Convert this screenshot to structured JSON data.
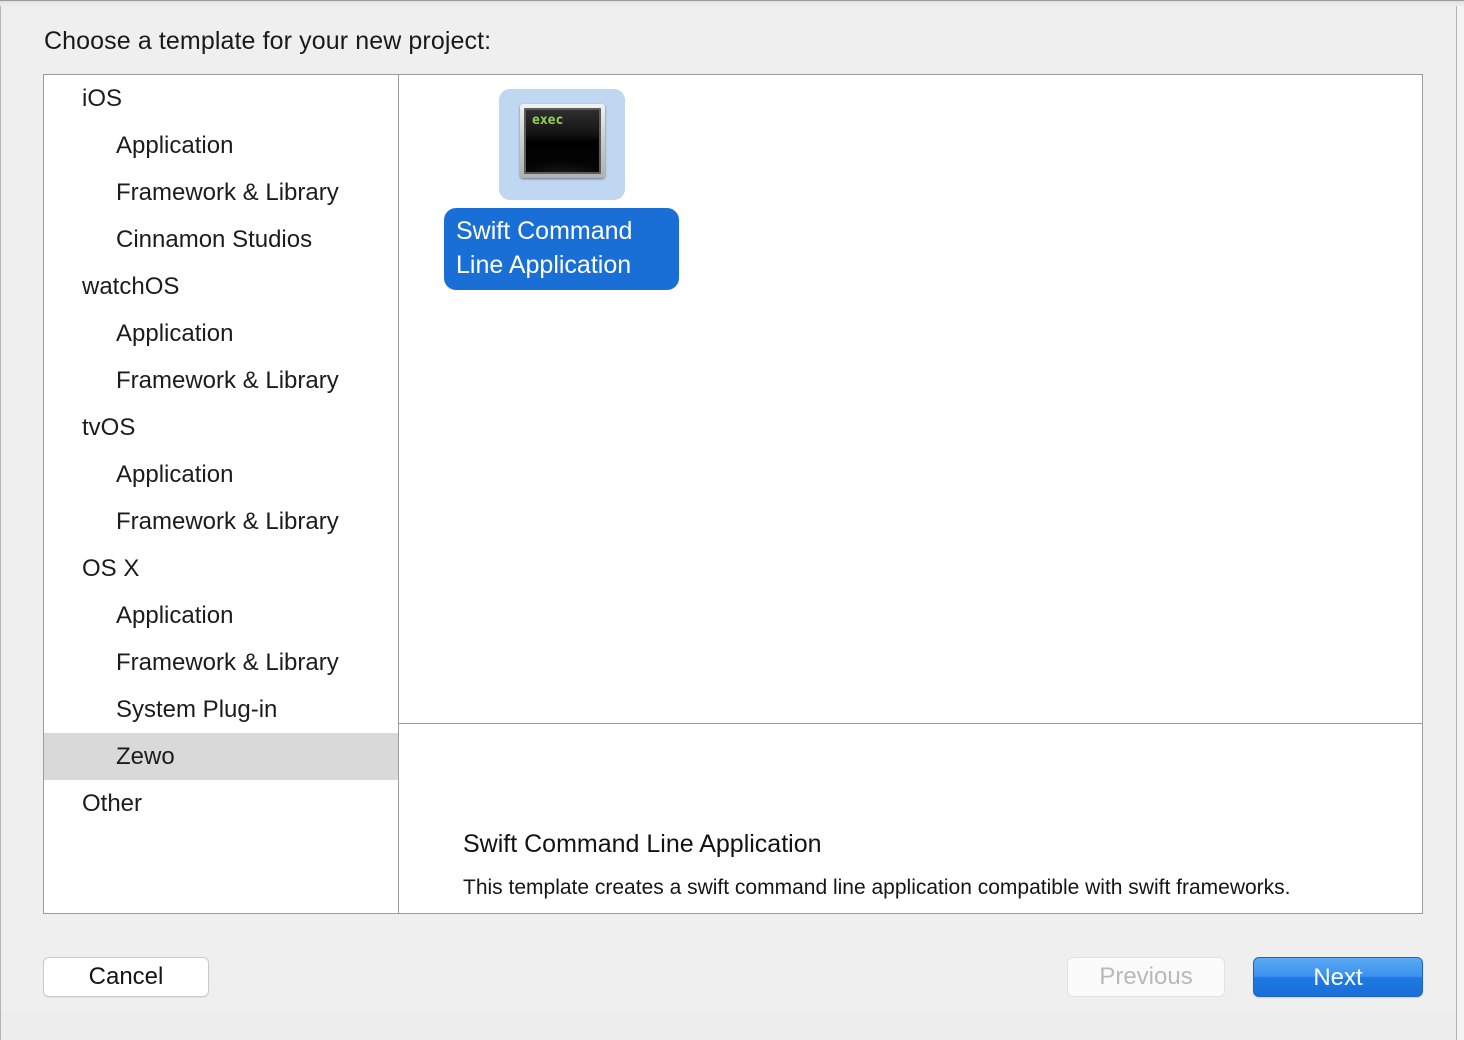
{
  "dialog": {
    "title": "Choose a template for your new project:"
  },
  "sidebar": {
    "rows": [
      {
        "label": "iOS",
        "level": "group",
        "selected": false
      },
      {
        "label": "Application",
        "level": "child",
        "selected": false
      },
      {
        "label": "Framework & Library",
        "level": "child",
        "selected": false
      },
      {
        "label": "Cinnamon Studios",
        "level": "child",
        "selected": false
      },
      {
        "label": "watchOS",
        "level": "group",
        "selected": false
      },
      {
        "label": "Application",
        "level": "child",
        "selected": false
      },
      {
        "label": "Framework & Library",
        "level": "child",
        "selected": false
      },
      {
        "label": "tvOS",
        "level": "group",
        "selected": false
      },
      {
        "label": "Application",
        "level": "child",
        "selected": false
      },
      {
        "label": "Framework & Library",
        "level": "child",
        "selected": false
      },
      {
        "label": "OS X",
        "level": "group",
        "selected": false
      },
      {
        "label": "Application",
        "level": "child",
        "selected": false
      },
      {
        "label": "Framework & Library",
        "level": "child",
        "selected": false
      },
      {
        "label": "System Plug-in",
        "level": "child",
        "selected": false
      },
      {
        "label": "Zewo",
        "level": "child",
        "selected": true
      },
      {
        "label": "Other",
        "level": "group",
        "selected": false
      }
    ]
  },
  "templates": {
    "items": [
      {
        "icon": "terminal-exec-icon",
        "icon_text": "exec",
        "label_line1": "Swift Command",
        "label_line2": "Line Application",
        "selected": true
      }
    ]
  },
  "description": {
    "title": "Swift Command Line Application",
    "body": "This template creates a swift command line application compatible with swift frameworks."
  },
  "footer": {
    "cancel_label": "Cancel",
    "previous_label": "Previous",
    "next_label": "Next"
  },
  "colors": {
    "accent_blue": "#1a6fd6",
    "next_button_blue": "#3c92ee",
    "icon_selection_blue": "#bfd7f0",
    "row_selection_gray": "#d9d9d9",
    "terminal_green": "#93d450",
    "window_background": "#efefef"
  }
}
